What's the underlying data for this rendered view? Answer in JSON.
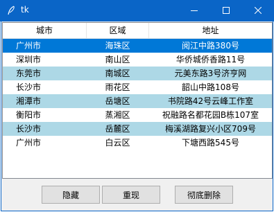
{
  "window": {
    "title": "tk"
  },
  "colors": {
    "titlebar": "#0a65c7",
    "selected_row": "#0078d7",
    "alt_row": "#add8e6"
  },
  "table": {
    "headers": [
      "城市",
      "区域",
      "地址"
    ],
    "rows": [
      {
        "city": "广州市",
        "district": "海珠区",
        "address": "阅江中路380号",
        "style": "selected"
      },
      {
        "city": "深圳市",
        "district": "南山区",
        "address": "华侨城侨香路11号",
        "style": "plain"
      },
      {
        "city": "东莞市",
        "district": "南城区",
        "address": "元美东路3号济亨网",
        "style": "alt"
      },
      {
        "city": "长沙市",
        "district": "雨花区",
        "address": "韶山中路108号",
        "style": "plain"
      },
      {
        "city": "湘潭市",
        "district": "岳塘区",
        "address": "书院路42号云峰工作室",
        "style": "alt"
      },
      {
        "city": "衡阳市",
        "district": "蒸湘区",
        "address": "祝融路名都花园B栋107室",
        "style": "plain"
      },
      {
        "city": "长沙市",
        "district": "岳麓区",
        "address": "梅溪湖路复兴小区709号",
        "style": "alt"
      },
      {
        "city": "广州市",
        "district": "白云区",
        "address": "下塘西路545号",
        "style": "plain"
      }
    ]
  },
  "buttons": {
    "hide": "隐藏",
    "show": "重现",
    "delete": "彻底删除"
  },
  "icons": {
    "app": "feather-icon",
    "minimize": "minimize-icon",
    "maximize": "maximize-icon",
    "close": "close-icon"
  }
}
